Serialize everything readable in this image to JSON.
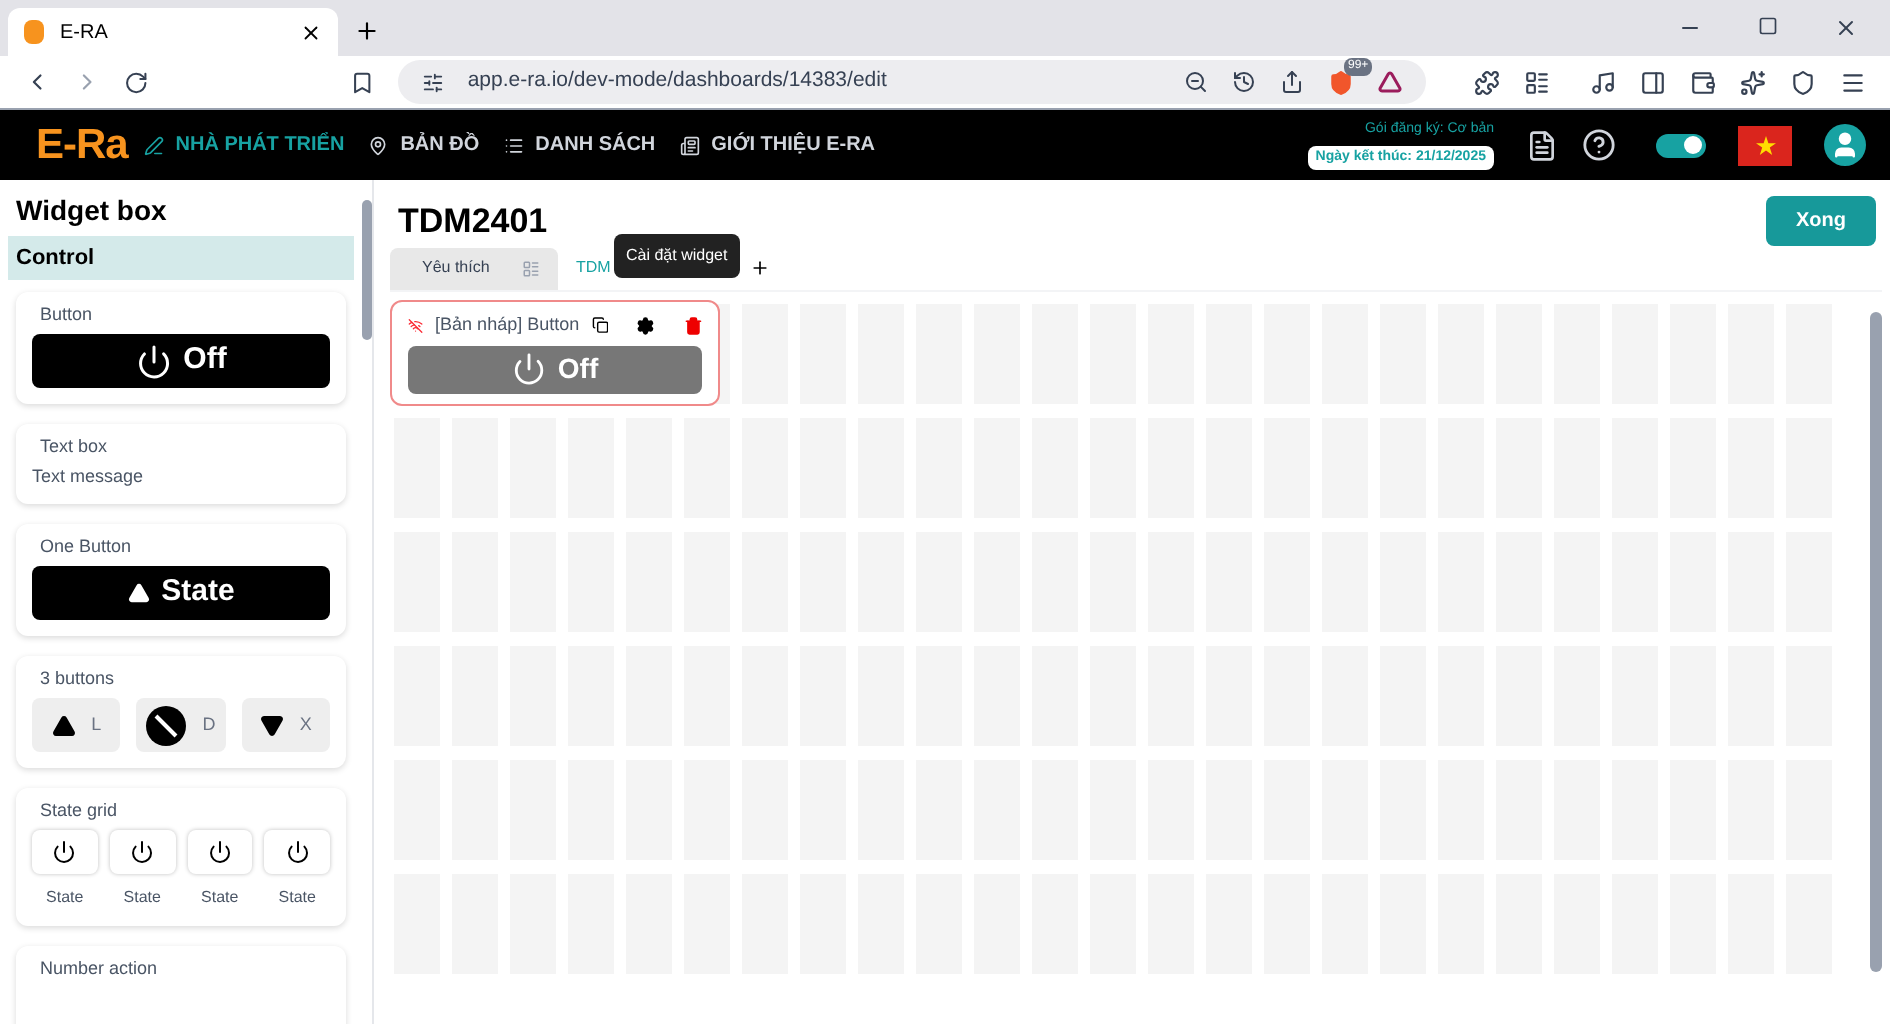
{
  "browser": {
    "tab_title": "E-RA",
    "url": "app.e-ra.io/dev-mode/dashboards/14383/edit",
    "shield_badge": "99+"
  },
  "nav": {
    "logo": "E-Ra",
    "items": [
      {
        "label": "NHÀ PHÁT TRIỂN",
        "selected": true
      },
      {
        "label": "BẢN ĐỒ",
        "selected": false
      },
      {
        "label": "DANH SÁCH",
        "selected": false
      },
      {
        "label": "GIỚI THIỆU E-RA",
        "selected": false
      }
    ],
    "plan": "Gói đăng ký: Cơ bản",
    "end_date": "Ngày kết thúc: 21/12/2025",
    "theme_toggle_on": true
  },
  "sidebar": {
    "title": "Widget box",
    "category": "Control",
    "widgets": [
      {
        "kind": "button",
        "title": "Button",
        "label": "Off"
      },
      {
        "kind": "textbox",
        "title": "Text box",
        "text": "Text message"
      },
      {
        "kind": "one_button",
        "title": "One Button",
        "label": "State"
      },
      {
        "kind": "three_buttons",
        "title": "3 buttons",
        "buttons": [
          "L",
          "D",
          "X"
        ]
      },
      {
        "kind": "state_grid",
        "title": "State grid",
        "states": [
          "State",
          "State",
          "State",
          "State"
        ]
      },
      {
        "kind": "number_action",
        "title": "Number action"
      }
    ]
  },
  "dashboard": {
    "title": "TDM2401",
    "tabs": [
      {
        "label": "Yêu thích",
        "selected": false
      },
      {
        "label": "TDM",
        "selected": true
      }
    ],
    "done_button": "Xong",
    "widget": {
      "title": "[Bản nháp] Button",
      "label": "Off"
    },
    "tooltip": "Cài đặt widget"
  }
}
